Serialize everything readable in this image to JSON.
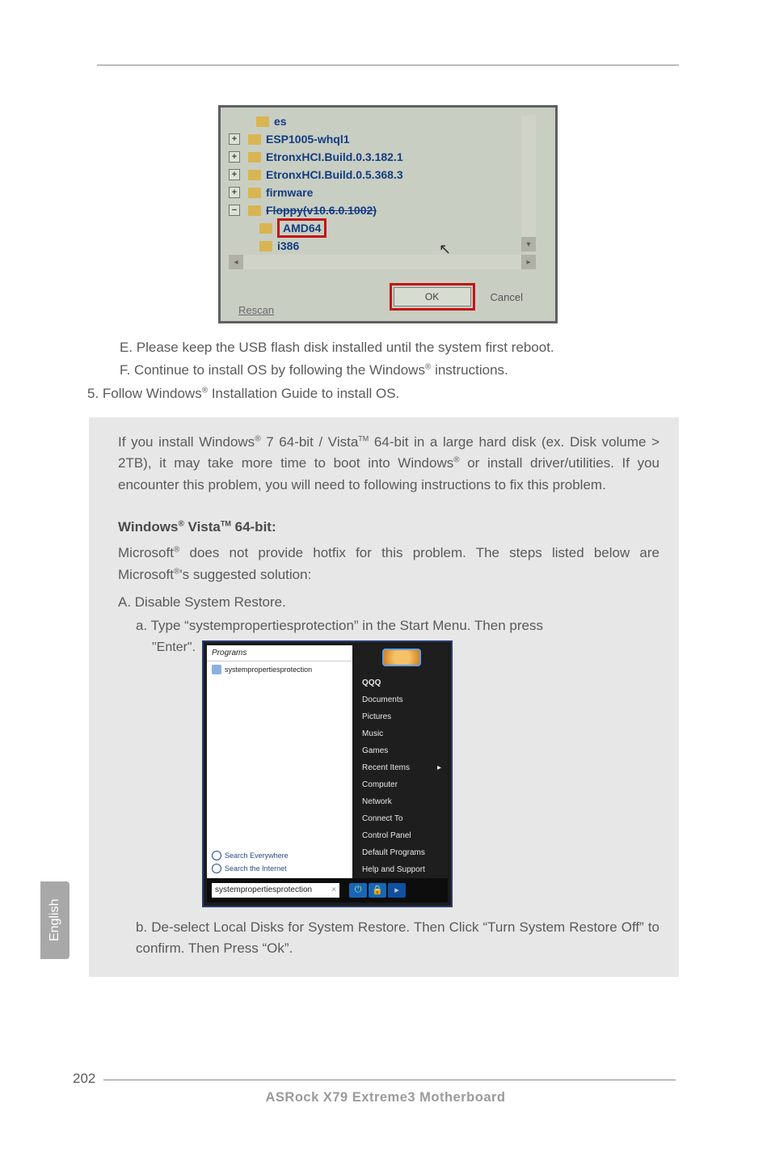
{
  "page_number": "202",
  "language_tab": "English",
  "footer": "ASRock  X79  Extreme3  Motherboard",
  "shot1": {
    "tree": {
      "r1": "es",
      "r2": "ESP1005-whql1",
      "r3": "EtronxHCI.Build.0.3.182.1",
      "r4": "EtronxHCI.Build.0.5.368.3",
      "r5": "firmware",
      "r6": "Floppy(v10.6.0.1002)",
      "amd": "AMD64",
      "i386": "i386"
    },
    "ok": "OK",
    "cancel": "Cancel",
    "rescan": "Rescan"
  },
  "steps": {
    "e": "E. Please keep the USB flash disk installed until the system first reboot.",
    "f_pre": "F. Continue to install OS by following the Windows",
    "f_post": " instructions.",
    "five_pre": "5. Follow Windows",
    "five_post": " Installation Guide to install OS."
  },
  "info": {
    "p1_a": "If you install Windows",
    "p1_b": " 7 64-bit / Vista",
    "p1_c": " 64-bit in a large hard disk (ex. Disk volume > 2TB), it may take more time to boot into Windows",
    "p1_d": " or install driver/utilities. If you encounter this problem, you will need to following instructions to fix this problem.",
    "heading_a": "Windows",
    "heading_b": " Vista",
    "heading_c": " 64-bit:",
    "p2_a": "Microsoft",
    "p2_b": " does not provide hotfix for this problem. The steps listed below are Microsoft",
    "p2_c": "'s suggested solution:",
    "A": "A. Disable System Restore.",
    "a_line": "a. Type “systempropertiesprotection” in the Start Menu. Then press",
    "enter": "\"Enter\".",
    "b_line": "b. De-select Local Disks for System Restore. Then Click “Turn System Restore Off” to confirm. Then Press “Ok”."
  },
  "shot2": {
    "programs": "Programs",
    "item1": "systempropertiesprotection",
    "search_everywhere": "Search Everywhere",
    "search_internet": "Search the Internet",
    "right": {
      "qqq": "QQQ",
      "docs": "Documents",
      "pics": "Pictures",
      "music": "Music",
      "games": "Games",
      "recent": "Recent Items",
      "computer": "Computer",
      "network": "Network",
      "connect": "Connect To",
      "control": "Control Panel",
      "default": "Default Programs",
      "help": "Help and Support"
    },
    "searchbox": "systempropertiesprotection",
    "x": "×"
  }
}
